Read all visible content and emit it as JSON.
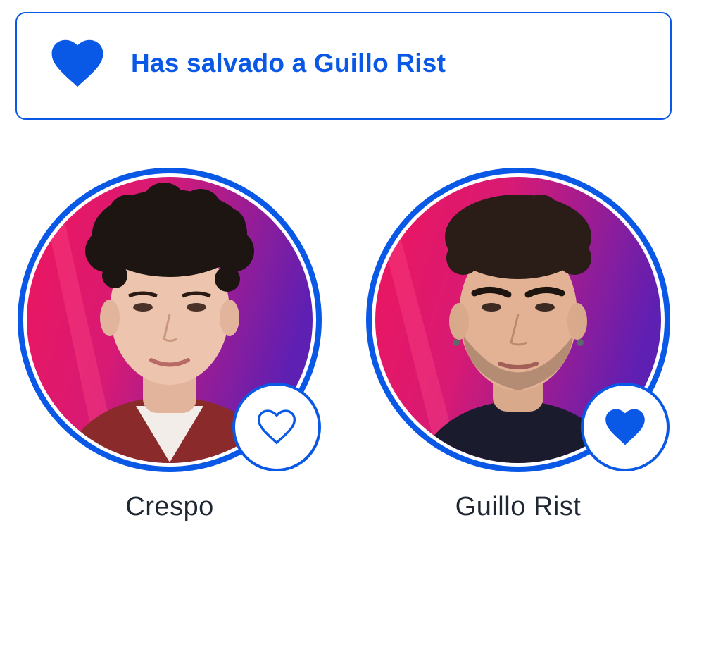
{
  "banner": {
    "icon": "heart-filled-icon",
    "message": "Has salvado a Guillo Rist"
  },
  "colors": {
    "accent": "#0a58e6",
    "name_text": "#1f2733",
    "photo_bg_left": "#e8175d",
    "photo_bg_right": "#6a1fb0"
  },
  "candidates": [
    {
      "name": "Crespo",
      "vote_icon": "heart-outline-icon",
      "saved": false
    },
    {
      "name": "Guillo Rist",
      "vote_icon": "heart-filled-icon",
      "saved": true
    }
  ]
}
